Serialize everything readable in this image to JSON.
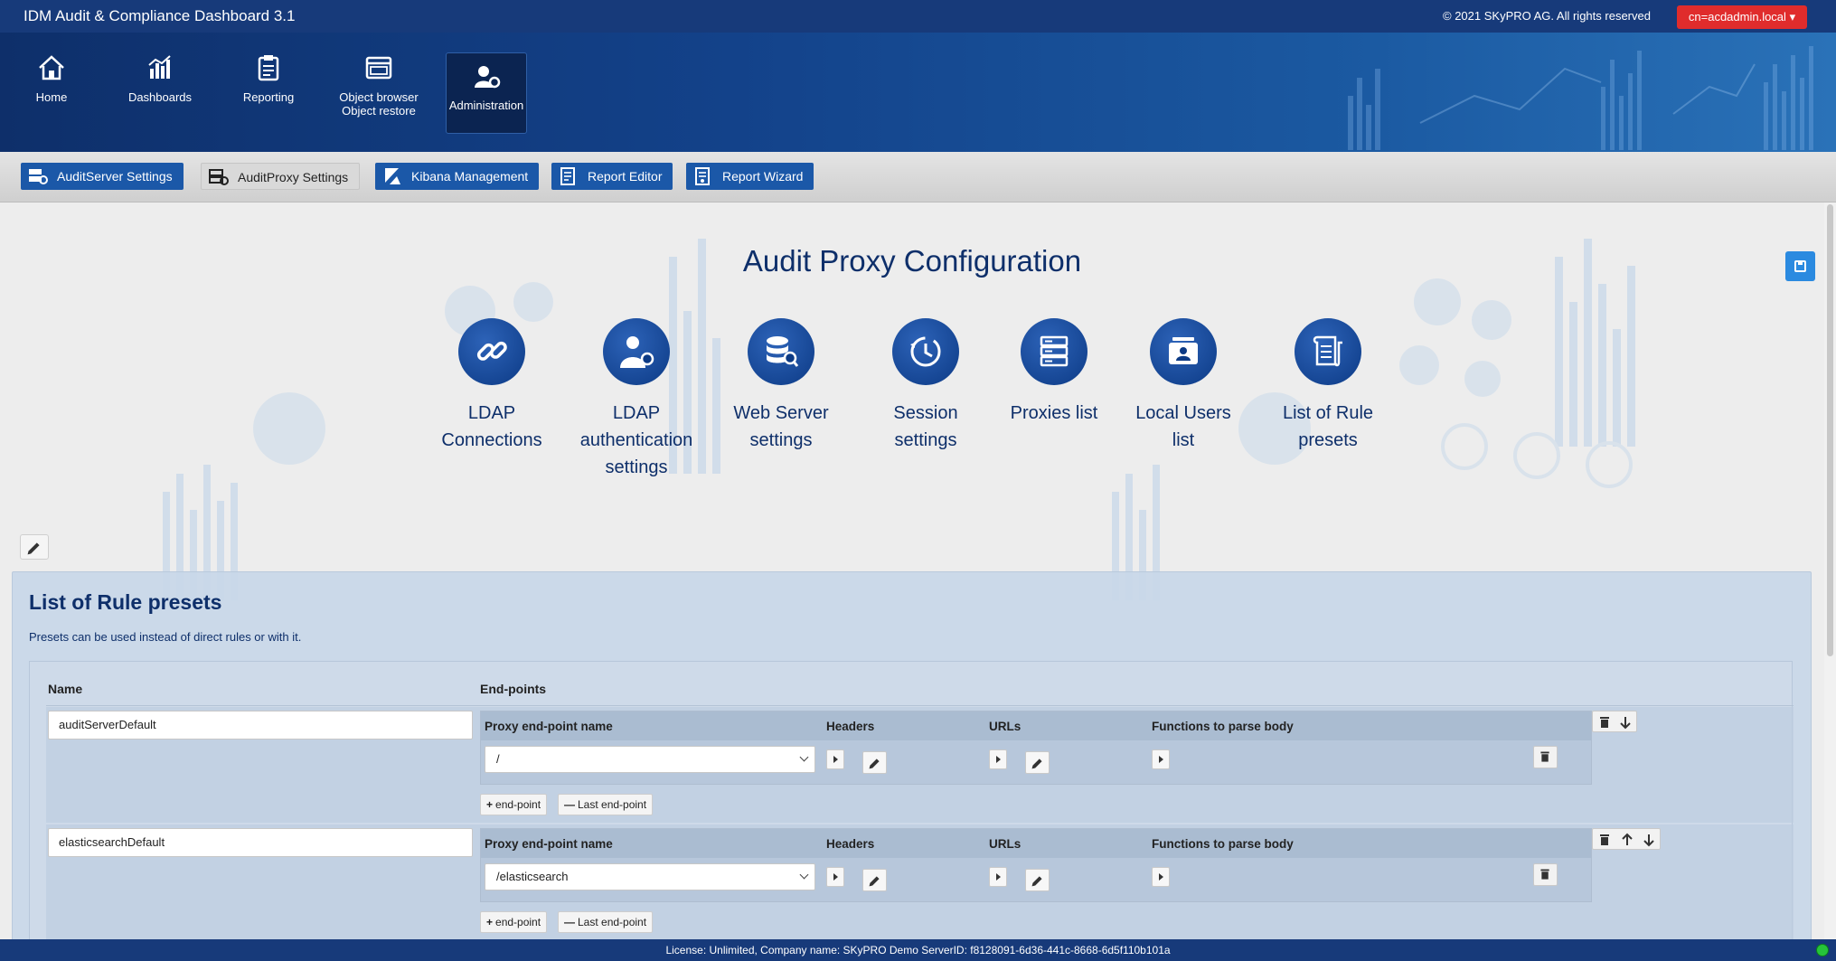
{
  "topbar": {
    "app_title": "IDM Audit & Compliance Dashboard 3.1",
    "copyright": "© 2021 SKyPRO AG. All rights reserved",
    "user": "cn=acdadmin.local"
  },
  "nav": {
    "home": "Home",
    "dashboards": "Dashboards",
    "reporting": "Reporting",
    "object_browser": "Object browser",
    "object_restore": "Object restore",
    "administration": "Administration"
  },
  "subnav": {
    "auditserver": "AuditServer Settings",
    "auditproxy": "AuditProxy Settings",
    "kibana": "Kibana Management",
    "report_editor": "Report Editor",
    "report_wizard": "Report Wizard"
  },
  "page": {
    "title": "Audit Proxy Configuration"
  },
  "tiles": {
    "ldap_connections": [
      "LDAP",
      "Connections"
    ],
    "ldap_auth": [
      "LDAP",
      "authentication",
      "settings"
    ],
    "web_server": [
      "Web Server",
      "settings"
    ],
    "session": [
      "Session",
      "settings"
    ],
    "proxies": [
      "Proxies list"
    ],
    "local_users": [
      "Local Users",
      "list"
    ],
    "rule_presets": [
      "List of Rule",
      "presets"
    ]
  },
  "presets_panel": {
    "title": "List of Rule presets",
    "description": "Presets can be used instead of direct rules or with it.",
    "col_name": "Name",
    "col_endpoints": "End-points",
    "ep_cols": {
      "name": "Proxy end-point name",
      "headers": "Headers",
      "urls": "URLs",
      "functions": "Functions to parse body"
    },
    "add_endpoint": "end-point",
    "last_endpoint": "Last end-point",
    "rows": [
      {
        "name": "auditServerDefault",
        "endpoint": "/"
      },
      {
        "name": "elasticsearchDefault",
        "endpoint": "/elasticsearch"
      }
    ]
  },
  "footer": {
    "license": "License: Unlimited, Company name: SKyPRO Demo ServerID:  f8128091-6d36-441c-8668-6d5f110b101a"
  },
  "colors": {
    "brand": "#173a7a",
    "accent": "#1b58a8",
    "user_button": "#e02c2c",
    "status_ok": "#26c43a"
  }
}
